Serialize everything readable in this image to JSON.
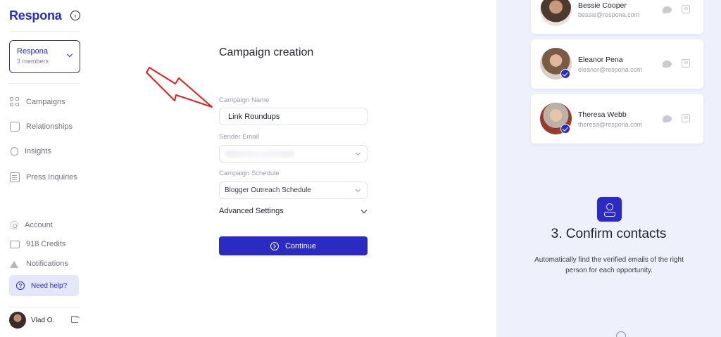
{
  "app": {
    "logo": "Respona"
  },
  "workspace": {
    "name": "Respona",
    "members": "3 members"
  },
  "nav": {
    "campaigns": "Campaigns",
    "relationships": "Relationships",
    "insights": "Insights",
    "press_inquiries": "Press Inquiries",
    "account": "Account",
    "credits": "918 Credits",
    "notifications": "Notifications",
    "help": "Need help?"
  },
  "user": {
    "name": "Vlad O."
  },
  "form": {
    "title": "Campaign creation",
    "campaign_name_label": "Campaign Name",
    "campaign_name_value": "Link Roundups",
    "sender_email_label": "Sender Email",
    "schedule_label": "Campaign Schedule",
    "schedule_value": "Blogger Outreach Schedule",
    "advanced_label": "Advanced Settings",
    "continue_label": "Continue"
  },
  "contacts": [
    {
      "name": "Bessie Cooper",
      "email": "bessie@respona.com",
      "verified": false
    },
    {
      "name": "Eleanor Pena",
      "email": "eleanor@respona.com",
      "verified": true
    },
    {
      "name": "Theresa Webb",
      "email": "theresa@respona.com",
      "verified": true
    }
  ],
  "step": {
    "title": "3. Confirm contacts",
    "description": "Automatically find the verified emails of the right person for each opportunity."
  },
  "colors": {
    "accent": "#2b2bc4",
    "panel_bg": "#eef0fb",
    "annotation": "#e02020"
  }
}
